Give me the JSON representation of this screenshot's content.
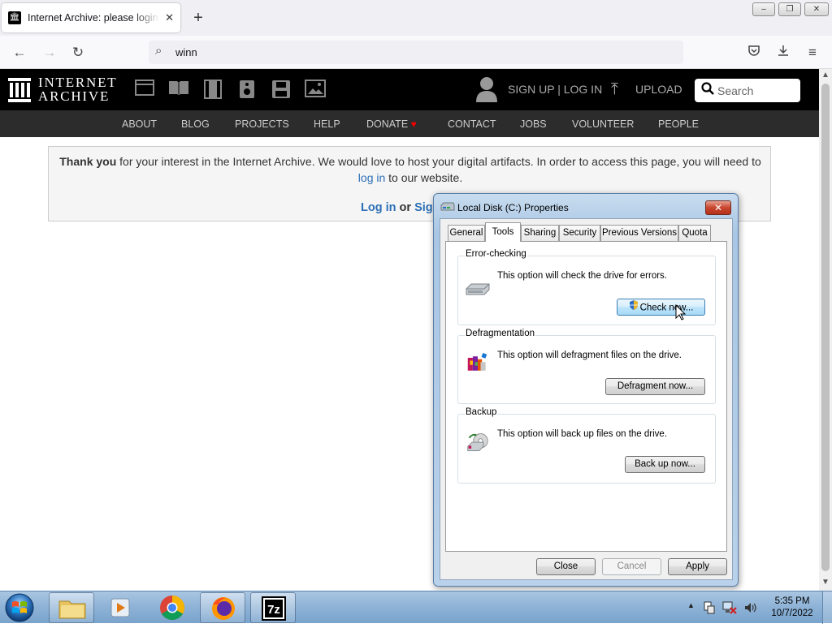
{
  "browser": {
    "tab_title": "Internet Archive: please login or",
    "tab_favicon": "archive-icon",
    "new_tab": "+",
    "url_text": "winn",
    "window_buttons": [
      "minimize",
      "restore",
      "close"
    ]
  },
  "ia": {
    "logo_line1": "INTERNET",
    "logo_line2": "ARCHIVE",
    "media_icons": [
      "web-icon",
      "texts-icon",
      "video-icon",
      "audio-icon",
      "software-icon",
      "images-icon"
    ],
    "signup_login": "SIGN UP | LOG IN",
    "upload": "UPLOAD",
    "search_placeholder": "Search",
    "menu": [
      "ABOUT",
      "BLOG",
      "PROJECTS",
      "HELP",
      "DONATE",
      "CONTACT",
      "JOBS",
      "VOLUNTEER",
      "PEOPLE"
    ],
    "notice": {
      "bold": "Thank you",
      "text1": " for your interest in the Internet Archive. We would love to host your digital artifacts. In order to access this page, you will need to ",
      "link": "log in",
      "text2": " to our website.",
      "login": "Log in",
      "or": "or",
      "signup": "Sig"
    }
  },
  "dialog": {
    "title": "Local Disk (C:) Properties",
    "tabs": [
      "General",
      "Tools",
      "Sharing",
      "Security",
      "Previous Versions",
      "Quota"
    ],
    "active_tab": "Tools",
    "groups": {
      "error_checking": {
        "label": "Error-checking",
        "text": "This option will check the drive for errors.",
        "button": "Check now..."
      },
      "defragmentation": {
        "label": "Defragmentation",
        "text": "This option will defragment files on the drive.",
        "button": "Defragment now..."
      },
      "backup": {
        "label": "Backup",
        "text": "This option will back up files on the drive.",
        "button": "Back up now..."
      }
    },
    "buttons": {
      "close": "Close",
      "cancel": "Cancel",
      "apply": "Apply"
    }
  },
  "taskbar": {
    "apps": [
      "windows-explorer-icon",
      "media-player-icon",
      "chrome-icon",
      "firefox-icon",
      "7zip-icon"
    ],
    "time": "5:35 PM",
    "date": "10/7/2022"
  }
}
